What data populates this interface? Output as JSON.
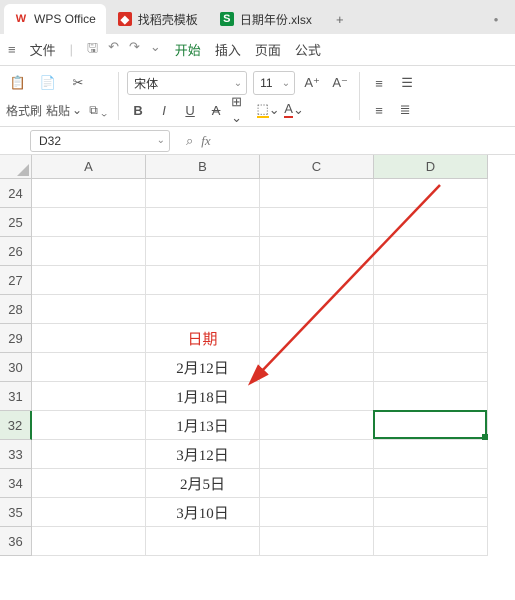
{
  "tabs": [
    {
      "icon": "W",
      "iconClass": "wps",
      "label": "WPS Office"
    },
    {
      "icon": "◆",
      "iconClass": "red",
      "label": "找稻壳模板"
    },
    {
      "icon": "S",
      "iconClass": "green",
      "label": "日期年份.xlsx"
    }
  ],
  "menu": {
    "file": "文件",
    "items": [
      "开始",
      "插入",
      "页面",
      "公式"
    ],
    "active_index": 0
  },
  "toolbar": {
    "format_painter": "格式刷",
    "paste": "粘贴",
    "font_name": "宋体",
    "font_size": "11"
  },
  "namebox": {
    "value": "D32",
    "fx": "fx"
  },
  "columns": [
    "A",
    "B",
    "C",
    "D"
  ],
  "row_start": 24,
  "row_end": 36,
  "selected_row": 32,
  "selected_col": "D",
  "data": {
    "B29": {
      "text": "日期",
      "header": true
    },
    "B30": {
      "text": "2月12日"
    },
    "B31": {
      "text": "1月18日"
    },
    "B32": {
      "text": "1月13日"
    },
    "B33": {
      "text": "3月12日"
    },
    "B34": {
      "text": "2月5日"
    },
    "B35": {
      "text": "3月10日"
    }
  }
}
